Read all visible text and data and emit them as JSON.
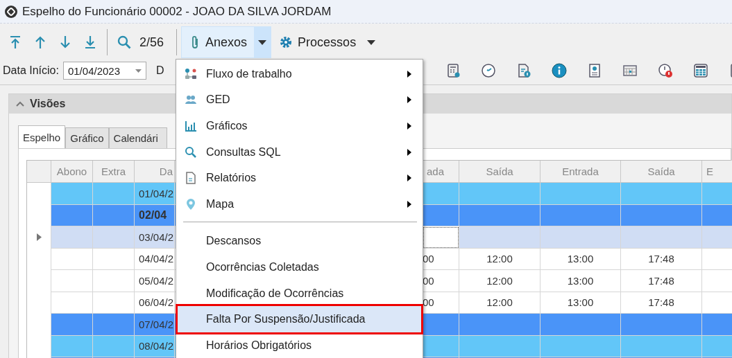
{
  "window": {
    "title": "Espelho do Funcionário 00002 - JOAO DA SILVA JORDAM"
  },
  "toolbar": {
    "counter": "2/56",
    "attachments": {
      "label": "Anexos",
      "pressed": true
    },
    "processes": {
      "label": "Processos"
    }
  },
  "filter": {
    "start_label": "Data Início:",
    "start_value": "01/04/2023",
    "end_label": "D"
  },
  "panel": {
    "title": "Visões",
    "expanded": true
  },
  "tabs": [
    {
      "label": "Espelho",
      "selected": true
    },
    {
      "label": "Gráfico",
      "selected": false
    },
    {
      "label": "Calendári",
      "selected": false
    }
  ],
  "table": {
    "columns": [
      "Abono",
      "Extra",
      "Da",
      "ada",
      "Saída",
      "Entrada",
      "Saída",
      "E"
    ],
    "rows": [
      {
        "date": "01/04/2",
        "color": "#62c6f8",
        "bold": false,
        "current": false,
        "times": []
      },
      {
        "date": "02/04",
        "color": "#4a94f8",
        "bold": true,
        "current": false,
        "times": []
      },
      {
        "date": "03/04/2",
        "color": "#d0ddf4",
        "bold": false,
        "current": true,
        "times": []
      },
      {
        "date": "04/04/2",
        "color": "#ffffff",
        "bold": false,
        "current": false,
        "times": [
          "00",
          "12:00",
          "13:00",
          "17:48"
        ]
      },
      {
        "date": "05/04/2",
        "color": "#ffffff",
        "bold": false,
        "current": false,
        "times": [
          "00",
          "12:00",
          "13:00",
          "17:48"
        ]
      },
      {
        "date": "06/04/2",
        "color": "#ffffff",
        "bold": false,
        "current": false,
        "times": [
          "00",
          "12:00",
          "13:00",
          "17:48"
        ]
      },
      {
        "date": "07/04/2",
        "color": "#4a94f8",
        "bold": false,
        "current": false,
        "times": []
      },
      {
        "date": "08/04/2",
        "color": "#62c6f8",
        "bold": false,
        "current": false,
        "times": []
      },
      {
        "color": "#4a94f8",
        "times": []
      }
    ]
  },
  "menu": {
    "items": [
      {
        "kind": "submenu",
        "label": "Fluxo de trabalho",
        "selected": false,
        "marked": false
      },
      {
        "kind": "submenu",
        "label": "GED",
        "selected": false,
        "marked": false
      },
      {
        "kind": "submenu",
        "label": "Gráficos",
        "selected": false,
        "marked": false
      },
      {
        "kind": "submenu",
        "label": "Consultas SQL",
        "selected": false,
        "marked": false
      },
      {
        "kind": "submenu",
        "label": "Relatórios",
        "selected": false,
        "marked": false
      },
      {
        "kind": "submenu",
        "label": "Mapa",
        "selected": false,
        "marked": false
      },
      {
        "kind": "separator"
      },
      {
        "kind": "plain",
        "label": "Descansos",
        "selected": false,
        "marked": false
      },
      {
        "kind": "plain",
        "label": "Ocorrências Coletadas",
        "selected": false,
        "marked": false
      },
      {
        "kind": "plain",
        "label": "Modificação de Ocorrências",
        "selected": false,
        "marked": false
      },
      {
        "kind": "plain",
        "label": "Falta Por Suspensão/Justificada",
        "selected": true,
        "marked": true
      },
      {
        "kind": "plain",
        "label": "Horários Obrigatórios",
        "selected": false,
        "marked": false
      }
    ]
  }
}
